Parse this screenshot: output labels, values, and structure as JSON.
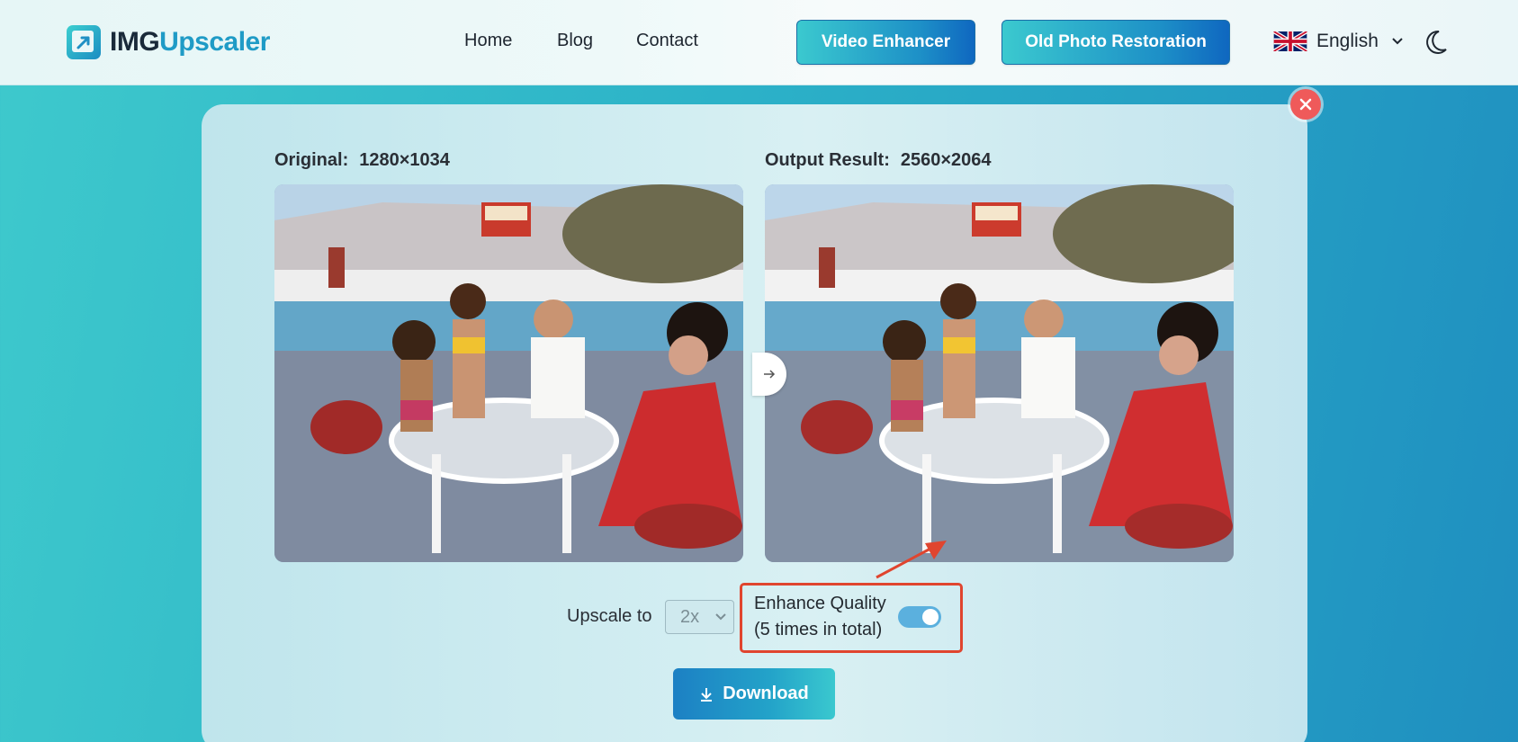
{
  "header": {
    "logo": {
      "part1": "IMG",
      "part2": "Upscaler"
    },
    "nav": {
      "home": "Home",
      "blog": "Blog",
      "contact": "Contact"
    },
    "buttons": {
      "video": "Video Enhancer",
      "old_photo": "Old Photo Restoration"
    },
    "language": {
      "selected": "English",
      "flag_icon": "uk-flag-icon"
    },
    "theme_icon": "moon-icon"
  },
  "result": {
    "original_label": "Original:",
    "original_size": "1280×1034",
    "output_label": "Output Result:",
    "output_size": "2560×2064"
  },
  "controls": {
    "upscale_label": "Upscale to",
    "upscale_value": "2x",
    "enhance_line1": "Enhance Quality",
    "enhance_line2": "(5 times in total)",
    "enhance_enabled": true,
    "download_label": "Download"
  },
  "colors": {
    "accent": "#1f9bc6",
    "highlight": "#e0452f",
    "close": "#ef5a5a",
    "toggle_on": "#5bb0de"
  }
}
